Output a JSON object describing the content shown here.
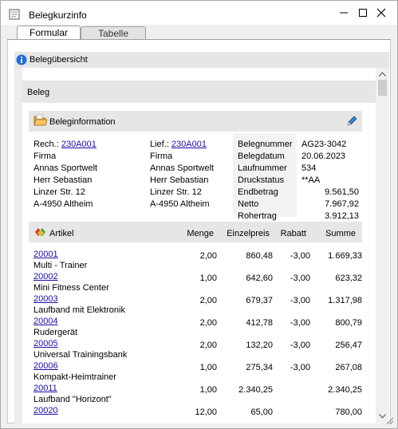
{
  "window": {
    "title": "Belegkurzinfo",
    "tabs": [
      {
        "label": "Formular",
        "active": true
      },
      {
        "label": "Tabelle",
        "active": false
      }
    ]
  },
  "overview": {
    "title": "Belegübersicht",
    "section_title": "Beleg"
  },
  "beleginfo": {
    "title": "Beleginformation",
    "rech_label": "Rech.:",
    "rech_link": "230A001",
    "rech_address": [
      "Firma",
      "Annas Sportwelt",
      "Herr Sebastian",
      "Linzer Str. 12",
      "A-4950 Altheim"
    ],
    "lief_label": "Lief.:",
    "lief_link": "230A001",
    "lief_address": [
      "Firma",
      "Annas Sportwelt",
      "Herr Sebastian",
      "Linzer Str. 12",
      "A-4950 Altheim"
    ],
    "fields": [
      {
        "label": "Belegnummer",
        "value": "AG23-3042"
      },
      {
        "label": "Belegdatum",
        "value": "20.06.2023"
      },
      {
        "label": "Laufnummer",
        "value": "534"
      },
      {
        "label": "Druckstatus",
        "value": "**AA"
      },
      {
        "label": "Endbetrag",
        "value": "9.561,50"
      },
      {
        "label": "Netto",
        "value": "7.967,92"
      },
      {
        "label": "Rohertrag",
        "value": "3.912,13"
      }
    ]
  },
  "artikel": {
    "headers": {
      "artikel": "Artikel",
      "menge": "Menge",
      "ep": "Einzelpreis",
      "rabatt": "Rabatt",
      "summe": "Summe"
    },
    "rows": [
      {
        "nr": "20001",
        "desc": "Multi - Trainer",
        "menge": "2,00",
        "ep": "860,48",
        "rabatt": "-3,00",
        "summe": "1.669,33"
      },
      {
        "nr": "20002",
        "desc": "Mini Fitness Center",
        "menge": "1,00",
        "ep": "642,60",
        "rabatt": "-3,00",
        "summe": "623,32"
      },
      {
        "nr": "20003",
        "desc": "Laufband mit Elektronik",
        "menge": "2,00",
        "ep": "679,37",
        "rabatt": "-3,00",
        "summe": "1.317,98"
      },
      {
        "nr": "20004",
        "desc": "Rudergerät",
        "menge": "2,00",
        "ep": "412,78",
        "rabatt": "-3,00",
        "summe": "800,79"
      },
      {
        "nr": "20005",
        "desc": "Universal Trainingsbank",
        "menge": "2,00",
        "ep": "132,20",
        "rabatt": "-3,00",
        "summe": "256,47"
      },
      {
        "nr": "20006",
        "desc": "Kompakt-Heimtrainer",
        "menge": "1,00",
        "ep": "275,34",
        "rabatt": "-3,00",
        "summe": "267,08"
      },
      {
        "nr": "20011",
        "desc": "Laufband \"Horizont\"",
        "menge": "1,00",
        "ep": "2.340,25",
        "rabatt": "",
        "summe": "2.340,25"
      },
      {
        "nr": "20020",
        "desc": "",
        "menge": "12,00",
        "ep": "65,00",
        "rabatt": "",
        "summe": "780,00"
      }
    ]
  },
  "colors": {
    "link": "#1a0dab",
    "header_bg": "#e6e6e6"
  },
  "icons": [
    "app-icon",
    "minimize-icon",
    "maximize-icon",
    "close-icon",
    "info-icon",
    "folder-icon",
    "pencil-icon",
    "artikel-icon",
    "scroll-up-icon",
    "scroll-down-icon",
    "resize-grip-icon"
  ]
}
